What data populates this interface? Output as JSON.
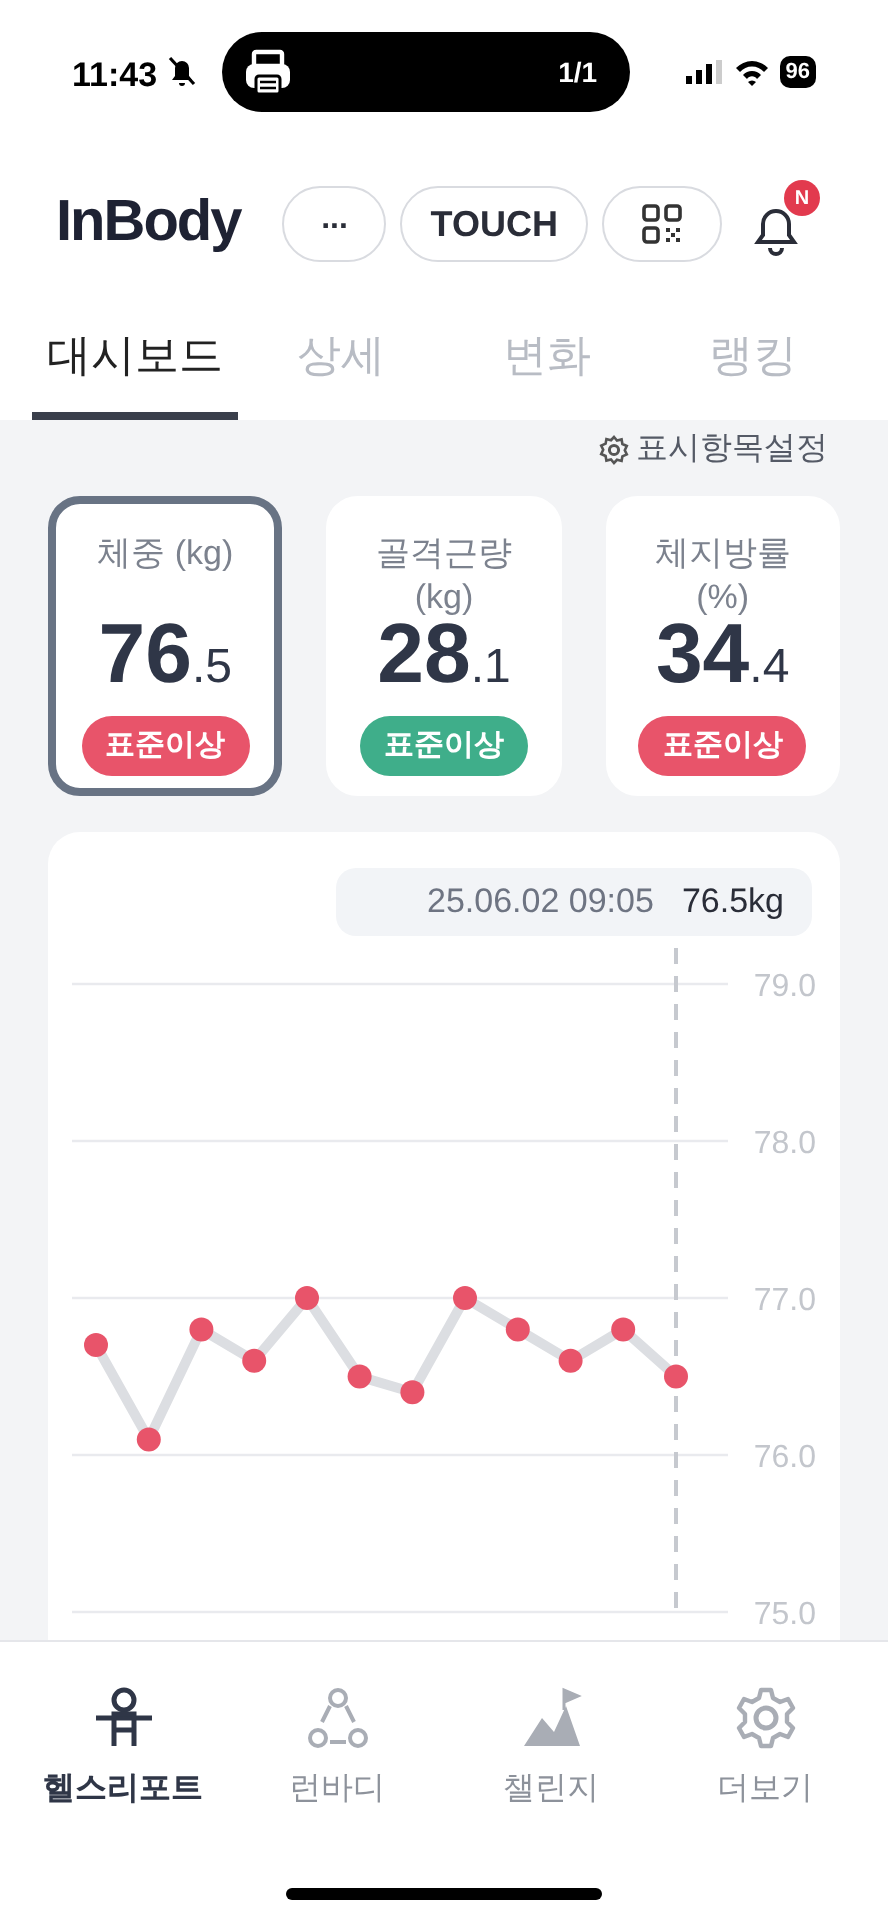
{
  "status_bar": {
    "time": "11:43",
    "activity": "1/1",
    "battery": "96"
  },
  "header": {
    "logo": "InBody",
    "buttons": [
      {
        "kind": "more",
        "label": "..."
      },
      {
        "kind": "text",
        "label": "TOUCH"
      },
      {
        "kind": "qr"
      }
    ],
    "notification_badge": "N"
  },
  "tabs": [
    {
      "label": "대시보드",
      "selected": true
    },
    {
      "label": "상세",
      "selected": false
    },
    {
      "label": "변화",
      "selected": false
    },
    {
      "label": "랭킹",
      "selected": false
    }
  ],
  "settings_link": "표시항목설정",
  "metrics": [
    {
      "label": "체중 (kg)",
      "whole": "76",
      "fraction": ".5",
      "badge": "표준이상",
      "color": "#e8546a",
      "selected": true
    },
    {
      "label": "골격근량 (kg)",
      "whole": "28",
      "fraction": ".1",
      "badge": "표준이상",
      "color": "#3fae8a",
      "selected": false
    },
    {
      "label": "체지방률 (%)",
      "whole": "34",
      "fraction": ".4",
      "badge": "표준이상",
      "color": "#e8546a",
      "selected": false
    }
  ],
  "chart": {
    "tooltip_time": "25.06.02 09:05",
    "tooltip_value": "76.5kg",
    "chart_data": {
      "type": "line",
      "grid": true,
      "series": [
        {
          "marker": true,
          "color": "#e8546a",
          "values": [
            76.7,
            76.1,
            76.8,
            76.6,
            77.0,
            76.5,
            76.4,
            77.0,
            76.8,
            76.6,
            76.8,
            76.5
          ]
        }
      ],
      "ylim": [
        75,
        79
      ],
      "yticks": [
        {
          "value": 79,
          "label": "79.0"
        },
        {
          "value": 78,
          "label": "78.0"
        },
        {
          "value": 77,
          "label": "77.0"
        },
        {
          "value": 76,
          "label": "76.0"
        },
        {
          "value": 75,
          "label": "75.0"
        }
      ]
    }
  },
  "bottom_nav": [
    {
      "kind": "report",
      "label": "헬스리포트",
      "selected": true
    },
    {
      "kind": "runbody",
      "label": "런바디",
      "selected": false
    },
    {
      "kind": "challenge",
      "label": "챌린지",
      "selected": false
    },
    {
      "kind": "more",
      "label": "더보기",
      "selected": false
    }
  ]
}
